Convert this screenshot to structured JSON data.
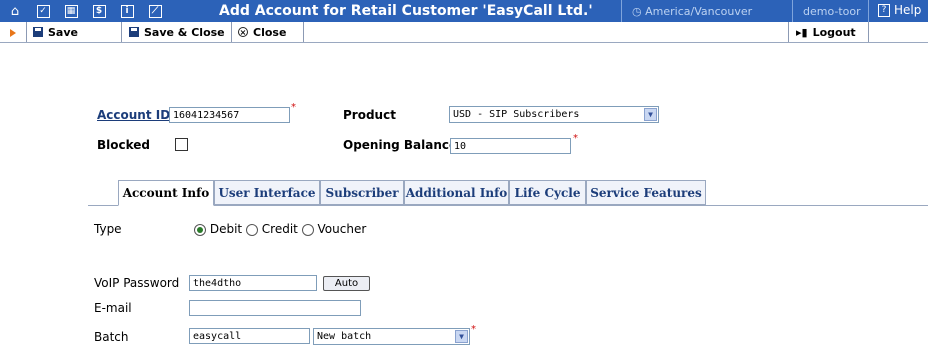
{
  "header": {
    "title": "Add Account for Retail Customer 'EasyCall Ltd.'",
    "timezone": "America/Vancouver",
    "user": "demo-toor",
    "help": "Help",
    "icons": [
      "home-icon",
      "checkbox-icon",
      "calculator-icon",
      "dollar-icon",
      "info-icon",
      "chart-icon"
    ]
  },
  "toolbar": {
    "save": "Save",
    "save_close": "Save & Close",
    "close": "Close",
    "logout": "Logout"
  },
  "form": {
    "account_id_label": "Account ID",
    "account_id_value": "16041234567",
    "blocked_label": "Blocked",
    "product_label": "Product",
    "product_value": "USD - SIP Subscribers",
    "opening_balance_label": "Opening Balance",
    "opening_balance_value": "10"
  },
  "tabs": [
    "Account Info",
    "User Interface",
    "Subscriber",
    "Additional Info",
    "Life Cycle",
    "Service Features"
  ],
  "account_info": {
    "type_label": "Type",
    "type_options": [
      "Debit",
      "Credit",
      "Voucher"
    ],
    "type_selected": "Debit",
    "voip_password_label": "VoIP Password",
    "voip_password_value": "the4dtho",
    "auto_button": "Auto",
    "email_label": "E-mail",
    "email_value": "",
    "batch_label": "Batch",
    "batch_value": "easycall",
    "batch_select": "New batch"
  },
  "colors": {
    "header_bg": "#2c62b8",
    "required": "#d01010",
    "tab_text": "#1c3d7a"
  }
}
